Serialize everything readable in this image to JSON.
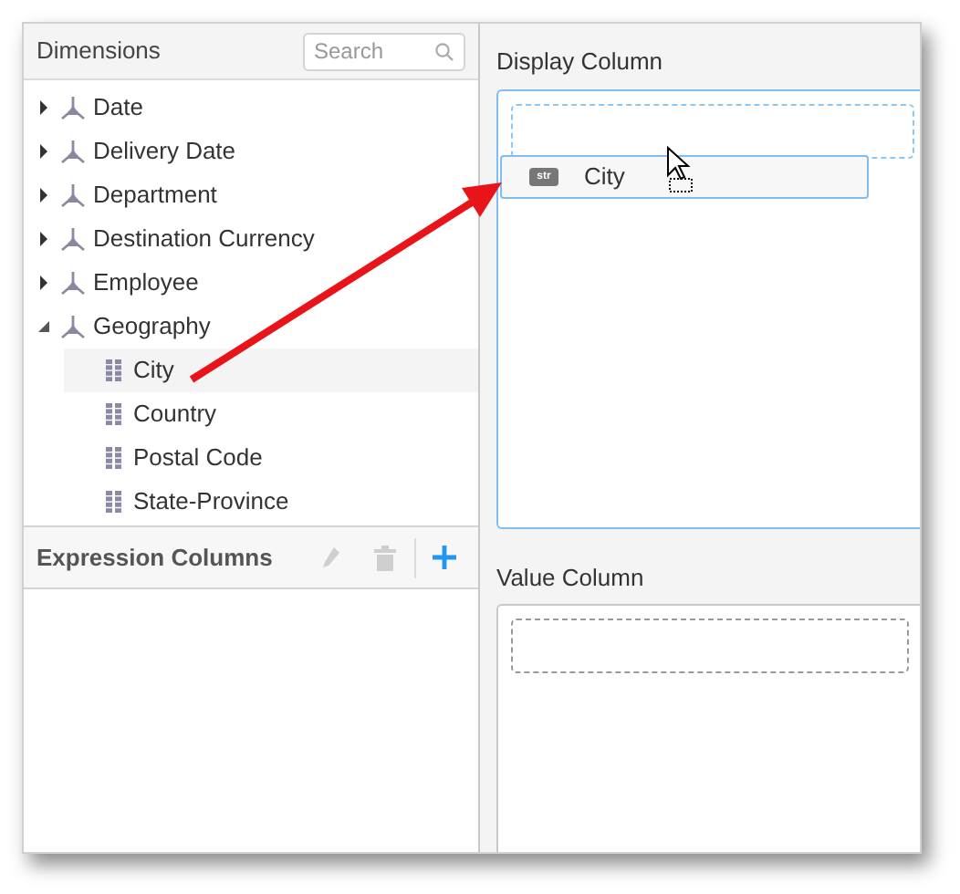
{
  "dimensions": {
    "title": "Dimensions",
    "search": {
      "placeholder": "Search"
    },
    "items": [
      {
        "label": "Date",
        "expanded": false
      },
      {
        "label": "Delivery Date",
        "expanded": false
      },
      {
        "label": "Department",
        "expanded": false
      },
      {
        "label": "Destination Currency",
        "expanded": false
      },
      {
        "label": "Employee",
        "expanded": false
      },
      {
        "label": "Geography",
        "expanded": true,
        "children": [
          {
            "label": "City",
            "selected": true
          },
          {
            "label": "Country",
            "selected": false
          },
          {
            "label": "Postal Code",
            "selected": false
          },
          {
            "label": "State-Province",
            "selected": false
          }
        ]
      }
    ]
  },
  "expression_columns": {
    "title": "Expression Columns",
    "edit_disabled": true,
    "delete_disabled": true
  },
  "display_column": {
    "label": "Display Column",
    "dragged_item": {
      "type_badge": "str",
      "label": "City"
    }
  },
  "value_column": {
    "label": "Value Column"
  }
}
